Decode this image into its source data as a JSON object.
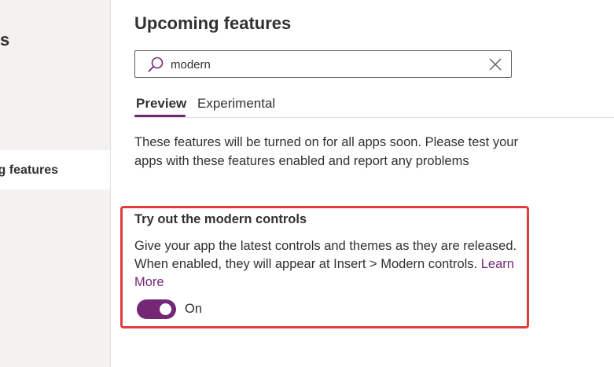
{
  "sidebar": {
    "heading": "s",
    "selected_item_label": "g features"
  },
  "main": {
    "title": "Upcoming features",
    "search": {
      "value": "modern",
      "icon": "search-icon",
      "clear_icon": "close-icon"
    },
    "tabs": [
      {
        "label": "Preview",
        "selected": true
      },
      {
        "label": "Experimental",
        "selected": false
      }
    ],
    "description": "These features will be turned on for all apps soon. Please test your apps with these features enabled and report any problems",
    "feature": {
      "title": "Try out the modern controls",
      "description": "Give your app the latest controls and themes as they are released. When enabled, they will appear at Insert > Modern controls.",
      "link_label": "Learn More",
      "toggle_state": "On",
      "toggle_on": true
    }
  },
  "colors": {
    "accent": "#742774",
    "highlight_border": "#e03c3c",
    "sidebar_bg": "#f3f2f1"
  }
}
